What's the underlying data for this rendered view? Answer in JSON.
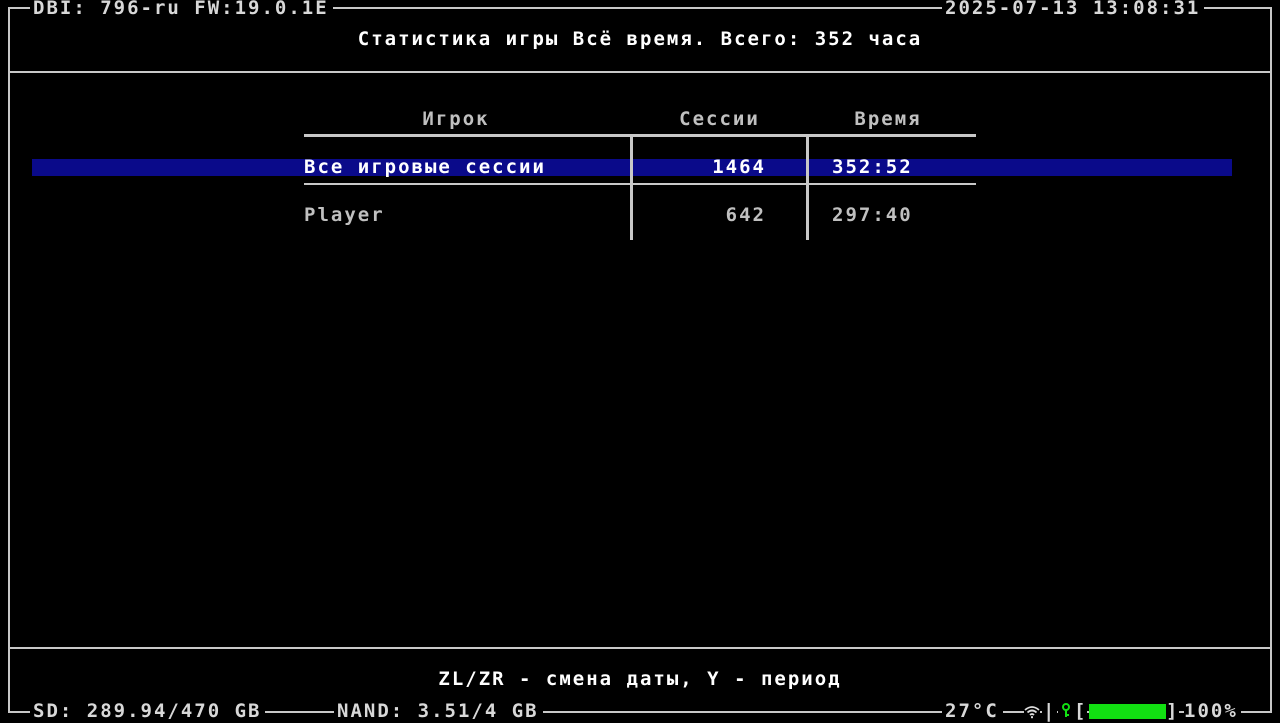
{
  "status_top": {
    "fw_label": "DBI: 796-ru FW:19.0.1E",
    "datetime": "2025-07-13 13:08:31"
  },
  "title": "Статистика игры Всё время. Всего: 352 часа",
  "table": {
    "headers": [
      "Игрок",
      "Сессии",
      "Время"
    ],
    "rows": [
      {
        "player": "Все игровые сессии",
        "sessions": "1464",
        "time": "352:52",
        "selected": true
      },
      {
        "player": "Player",
        "sessions": "642",
        "time": "297:40",
        "selected": false
      }
    ]
  },
  "hint": "ZL/ZR - смена даты, Y - период",
  "status_bottom": {
    "sd": "SD: 289.94/470 GB",
    "nand": "NAND: 3.51/4 GB",
    "temp": "27°C",
    "battery_left": "[",
    "battery_right": "]",
    "battery_pct": "100%",
    "battery_level": 1.0,
    "wifi_icon": "wifi-icon",
    "key_icon": "key-icon",
    "accent_green": "#12e012",
    "selection_blue": "#0a0a8a"
  }
}
